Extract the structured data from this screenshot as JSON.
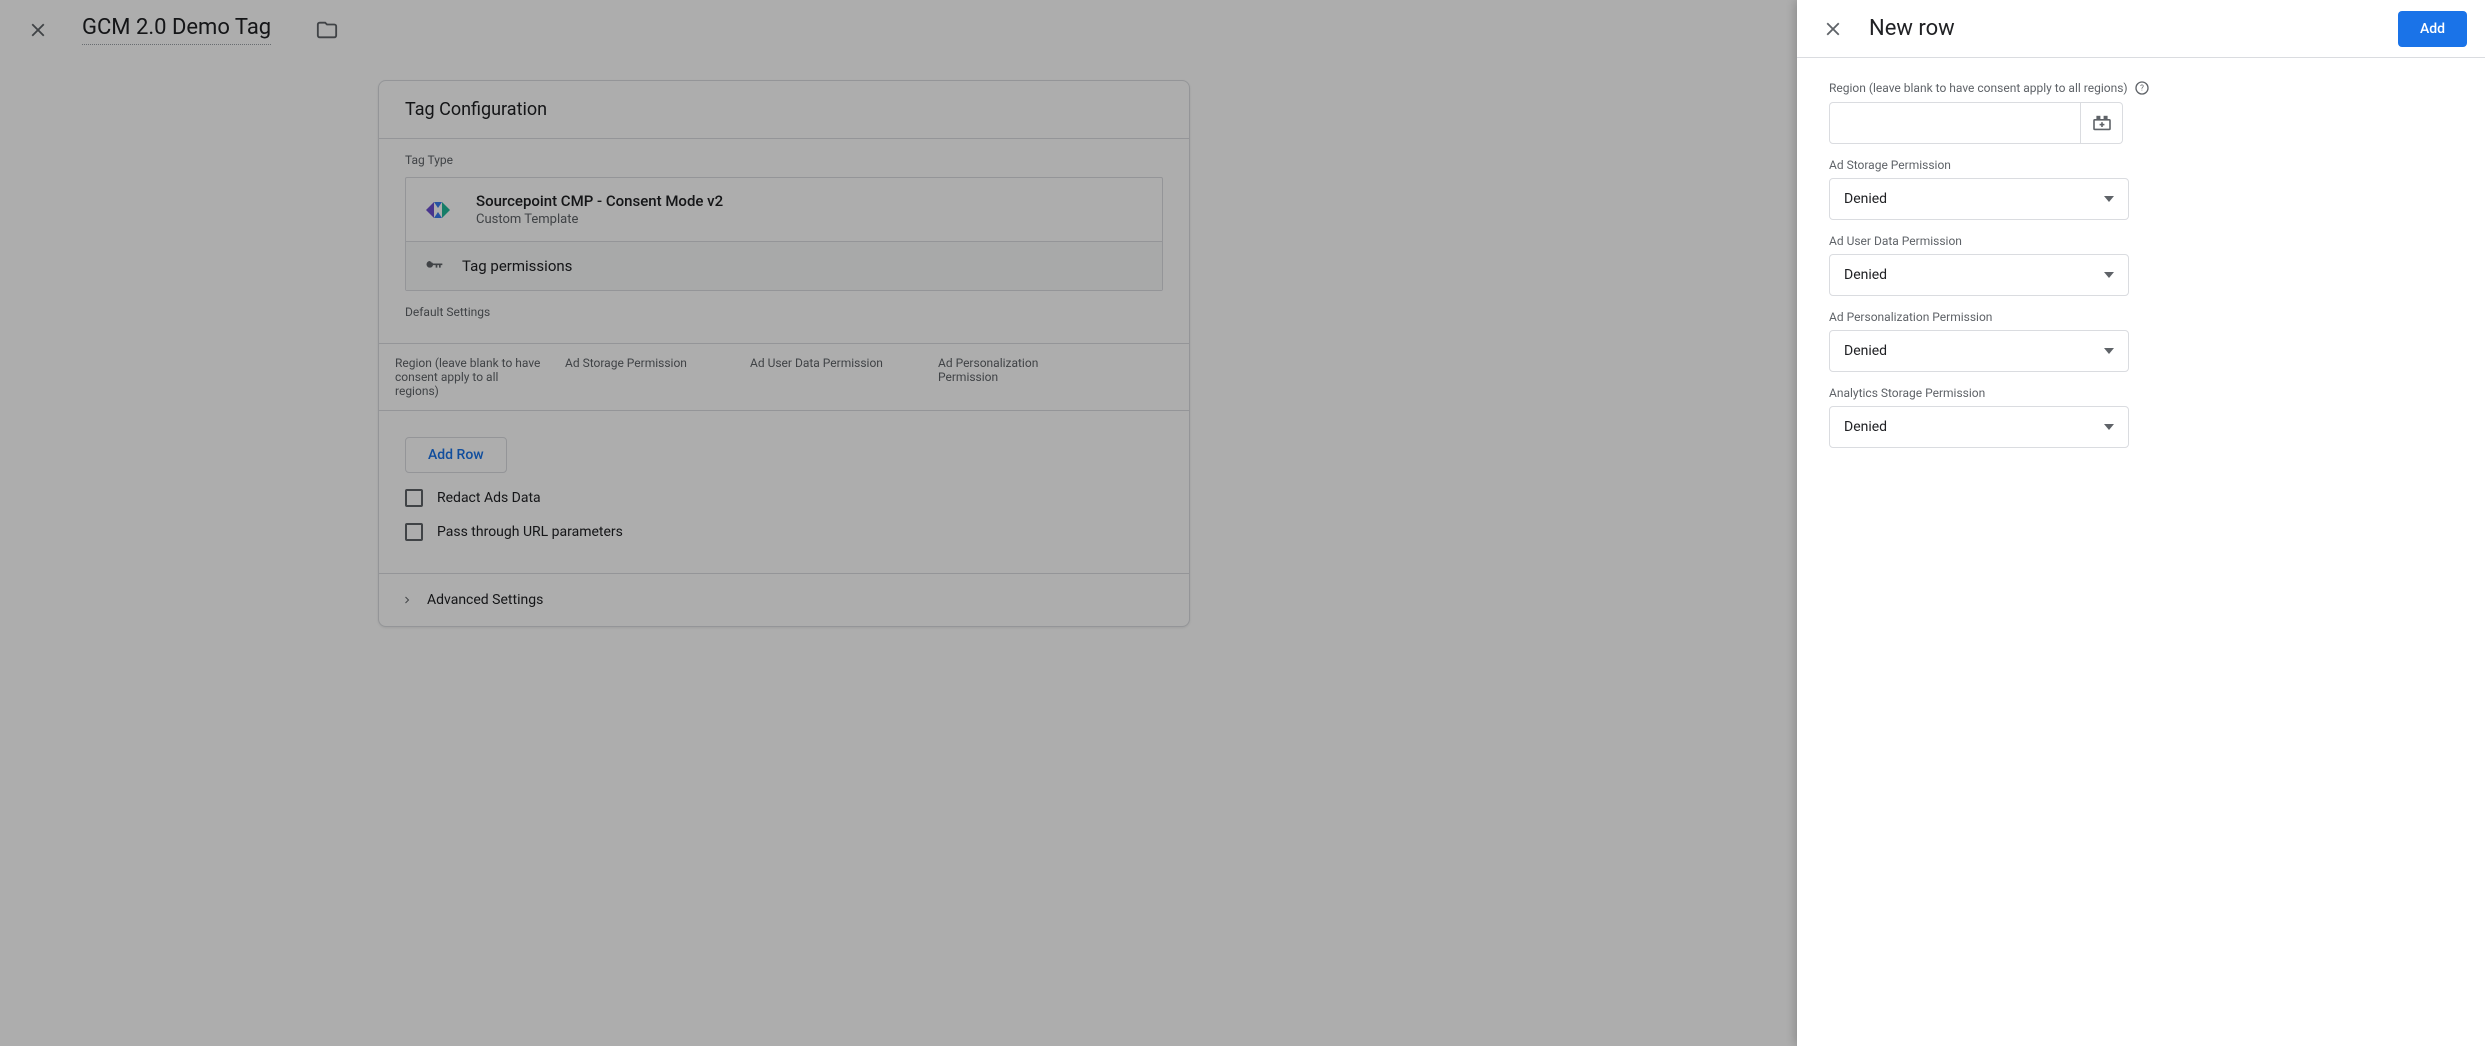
{
  "page": {
    "tag_name": "GCM 2.0 Demo Tag",
    "card_title": "Tag Configuration",
    "tag_type_label": "Tag Type",
    "tag_type": {
      "title": "Sourcepoint CMP - Consent Mode v2",
      "subtitle": "Custom Template"
    },
    "tag_permissions_label": "Tag permissions",
    "default_settings_label": "Default Settings",
    "table_headers": {
      "region": "Region (leave blank to have consent apply to all regions)",
      "ad_storage": "Ad Storage Permission",
      "ad_user_data": "Ad User Data Permission",
      "ad_personalization": "Ad Personalization Permission"
    },
    "add_row_label": "Add Row",
    "checkboxes": {
      "redact": "Redact Ads Data",
      "passthrough": "Pass through URL parameters"
    },
    "advanced_settings": "Advanced Settings"
  },
  "panel": {
    "title": "New row",
    "add_label": "Add",
    "fields": {
      "region": {
        "label": "Region (leave blank to have consent apply to all regions)",
        "value": ""
      },
      "ad_storage": {
        "label": "Ad Storage Permission",
        "value": "Denied"
      },
      "ad_user_data": {
        "label": "Ad User Data Permission",
        "value": "Denied"
      },
      "ad_personalization": {
        "label": "Ad Personalization Permission",
        "value": "Denied"
      },
      "analytics_storage": {
        "label": "Analytics Storage Permission",
        "value": "Denied"
      }
    }
  }
}
